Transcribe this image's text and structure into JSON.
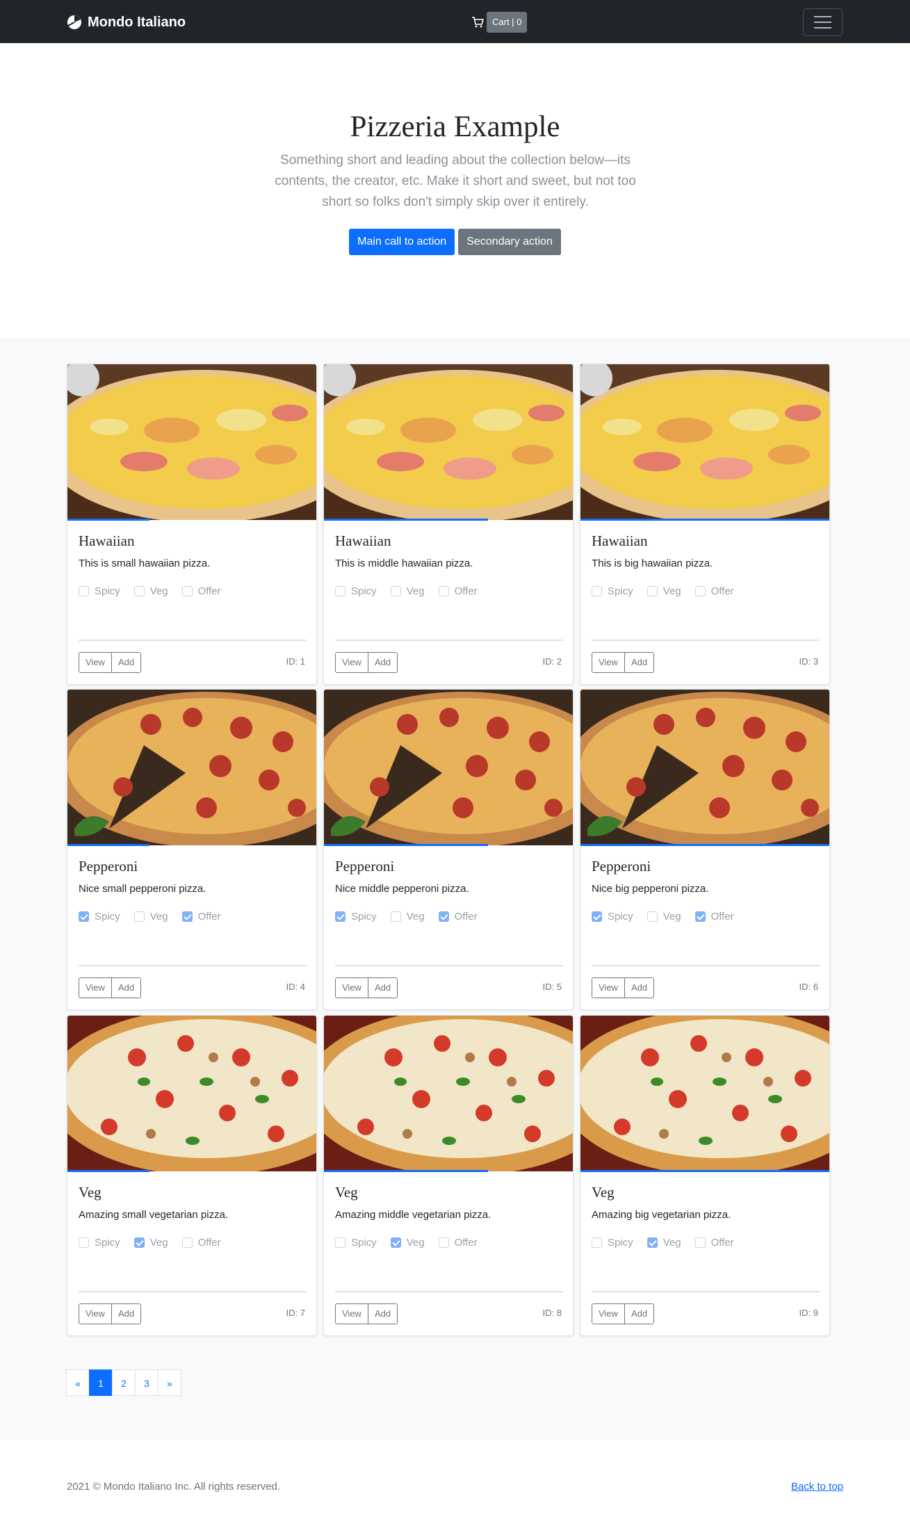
{
  "navbar": {
    "brand": "Mondo Italiano",
    "brand_icon": "pie-logo-icon",
    "cart_icon": "cart-icon",
    "cart_label": "Cart | 0",
    "menu_icon": "hamburger-icon"
  },
  "hero": {
    "title": "Pizzeria Example",
    "lead": "Something short and leading about the collection below—its contents, the creator, etc. Make it short and sweet, but not too short so folks don't simply skip over it entirely.",
    "primary_label": "Main call to action",
    "secondary_label": "Secondary action"
  },
  "labels": {
    "spicy": "Spicy",
    "veg": "Veg",
    "offer": "Offer",
    "view": "View",
    "add": "Add"
  },
  "cards": [
    {
      "title": "Hawaiian",
      "desc": "This is small hawaiian pizza.",
      "id": "ID: 1",
      "image": "hawaiian-pizza",
      "spicy": false,
      "veg": false,
      "offer": false
    },
    {
      "title": "Hawaiian",
      "desc": "This is middle hawaiian pizza.",
      "id": "ID: 2",
      "image": "hawaiian-pizza",
      "spicy": false,
      "veg": false,
      "offer": false
    },
    {
      "title": "Hawaiian",
      "desc": "This is big hawaiian pizza.",
      "id": "ID: 3",
      "image": "hawaiian-pizza",
      "spicy": false,
      "veg": false,
      "offer": false
    },
    {
      "title": "Pepperoni",
      "desc": "Nice small pepperoni pizza.",
      "id": "ID: 4",
      "image": "pepperoni-pizza",
      "spicy": true,
      "veg": false,
      "offer": true
    },
    {
      "title": "Pepperoni",
      "desc": "Nice middle pepperoni pizza.",
      "id": "ID: 5",
      "image": "pepperoni-pizza",
      "spicy": true,
      "veg": false,
      "offer": true
    },
    {
      "title": "Pepperoni",
      "desc": "Nice big pepperoni pizza.",
      "id": "ID: 6",
      "image": "pepperoni-pizza",
      "spicy": true,
      "veg": false,
      "offer": true
    },
    {
      "title": "Veg",
      "desc": "Amazing small vegetarian pizza.",
      "id": "ID: 7",
      "image": "veg-pizza",
      "spicy": false,
      "veg": true,
      "offer": false
    },
    {
      "title": "Veg",
      "desc": "Amazing middle vegetarian pizza.",
      "id": "ID: 8",
      "image": "veg-pizza",
      "spicy": false,
      "veg": true,
      "offer": false
    },
    {
      "title": "Veg",
      "desc": "Amazing big vegetarian pizza.",
      "id": "ID: 9",
      "image": "veg-pizza",
      "spicy": false,
      "veg": true,
      "offer": false
    }
  ],
  "pagination": {
    "prev": "«",
    "pages": [
      "1",
      "2",
      "3"
    ],
    "active": "1",
    "next": "»"
  },
  "footer": {
    "copyright": "2021 © Mondo Italiano Inc. All rights reserved.",
    "back_to_top": "Back to top"
  },
  "colors": {
    "navbar_bg": "#212529",
    "primary": "#0d6efd",
    "secondary": "#6c757d",
    "album_bg": "#f8f9fa"
  }
}
